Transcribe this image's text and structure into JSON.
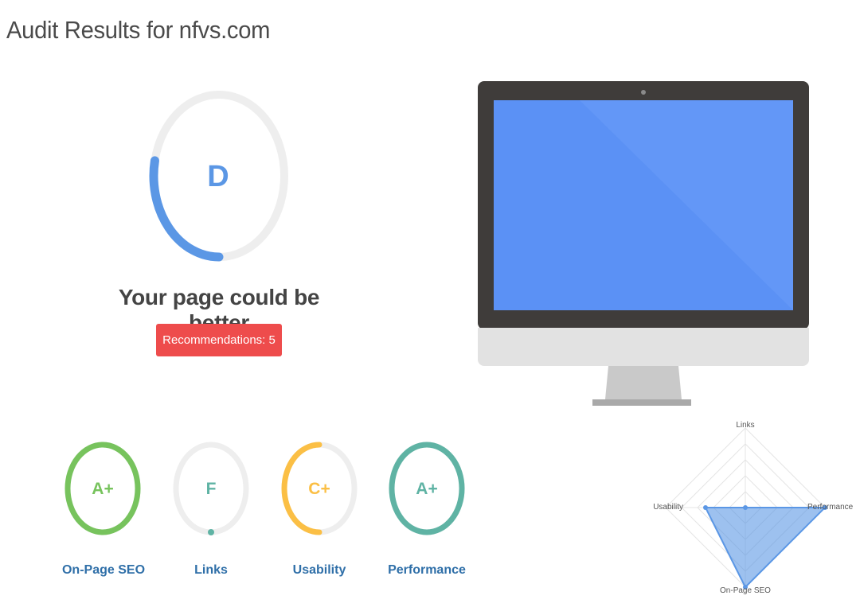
{
  "title": "Audit Results for nfvs.com",
  "overall": {
    "grade": "D",
    "score_fraction": 0.28,
    "color": "#5b97e5",
    "track_color": "#eeeeee"
  },
  "verdict": "Your page could be better",
  "recommendations": {
    "label": "Recommendations: 5",
    "color": "#ee4c4c"
  },
  "categories": [
    {
      "grade": "A+",
      "name": "On-Page SEO",
      "fraction": 1.0,
      "color": "#77c35d"
    },
    {
      "grade": "F",
      "name": "Links",
      "fraction": 0.0,
      "color": "#5fb3a4"
    },
    {
      "grade": "C+",
      "name": "Usability",
      "fraction": 0.5,
      "color": "#fbbf45"
    },
    {
      "grade": "A+",
      "name": "Performance",
      "fraction": 1.0,
      "color": "#5fb3a4"
    }
  ],
  "colors": {
    "label_blue": "#2f6fa8",
    "screen_blue": "#5b91f5",
    "bezel": "#3f3c3a"
  },
  "chart_data": {
    "type": "radar",
    "axes": [
      "Links",
      "Performance",
      "On-Page SEO",
      "Usability"
    ],
    "values": [
      0,
      100,
      100,
      50
    ],
    "rmax": 100,
    "color": "#5b97e5"
  }
}
